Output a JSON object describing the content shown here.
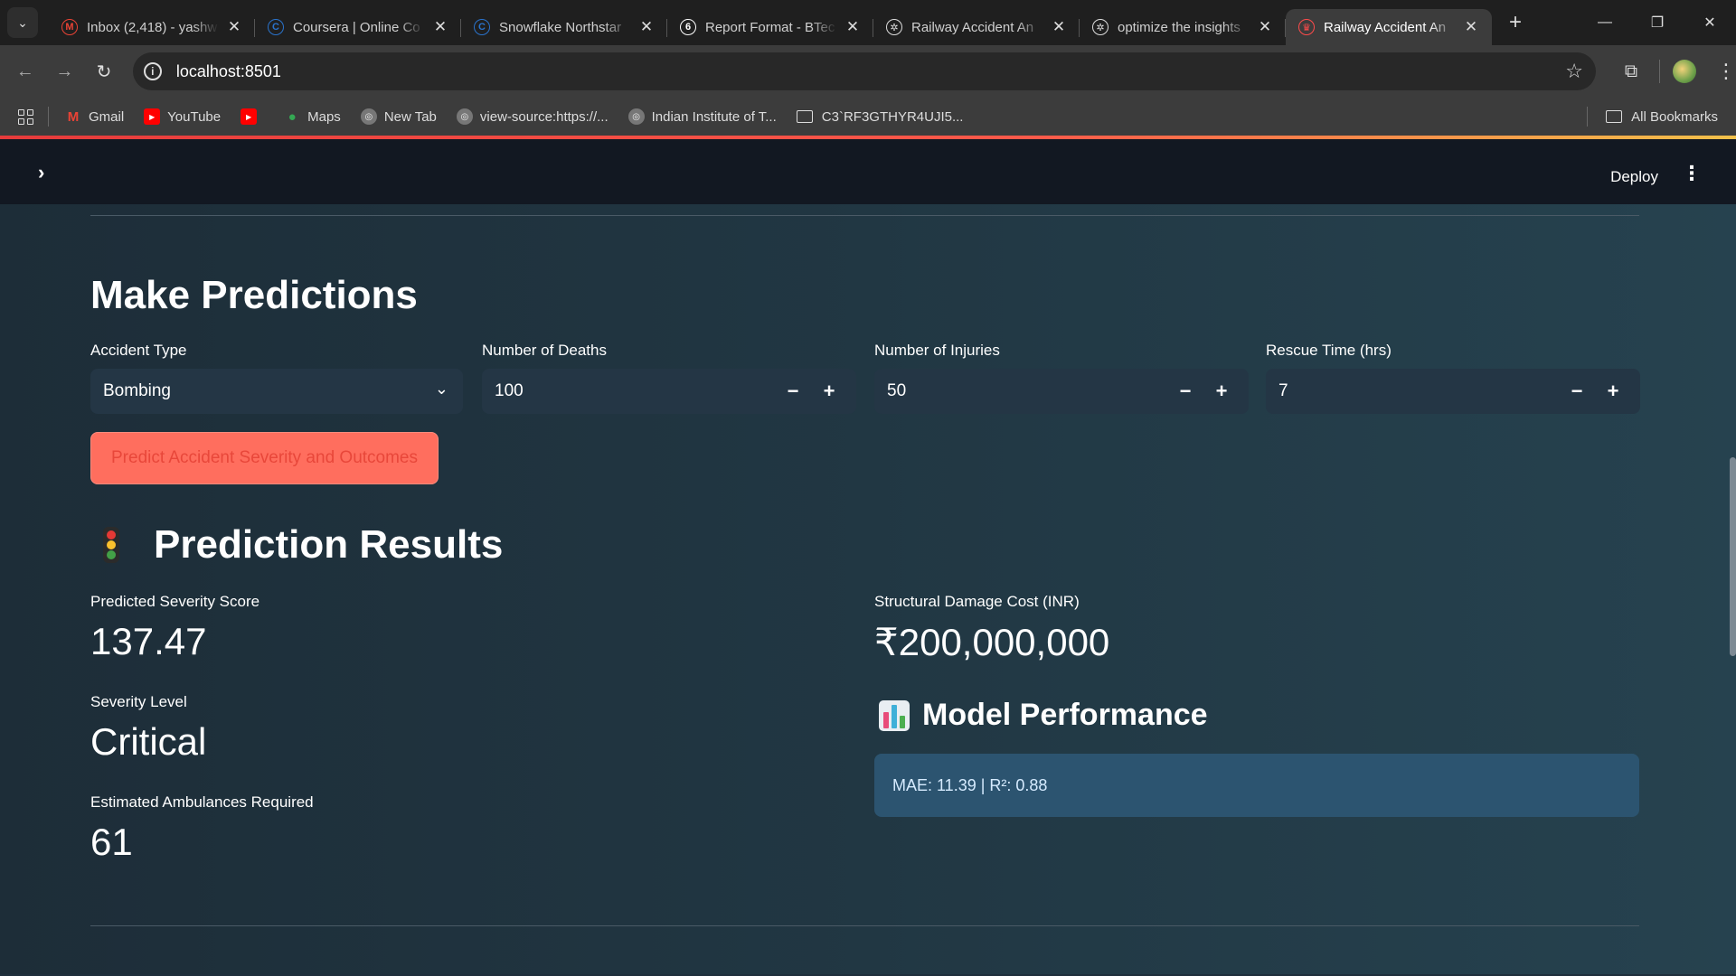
{
  "browser": {
    "tabs": [
      {
        "title": "Inbox (2,418) - yashw",
        "favicon": "gmail-icon",
        "color": "#ea4335",
        "glyph": "M",
        "active": false
      },
      {
        "title": "Coursera | Online Co",
        "favicon": "coursera-icon",
        "color": "#2a73cc",
        "glyph": "C",
        "active": false
      },
      {
        "title": "Snowflake Northstar",
        "favicon": "coursera-icon",
        "color": "#2a73cc",
        "glyph": "C",
        "active": false
      },
      {
        "title": "Report Format - BTec",
        "favicon": "document-icon",
        "color": "#ffffff",
        "glyph": "6",
        "active": false
      },
      {
        "title": "Railway Accident An",
        "favicon": "openai-icon",
        "color": "#dddddd",
        "glyph": "✲",
        "active": false
      },
      {
        "title": "optimize the insights",
        "favicon": "openai-icon",
        "color": "#dddddd",
        "glyph": "✲",
        "active": false
      },
      {
        "title": "Railway Accident An",
        "favicon": "streamlit-icon",
        "color": "#ff4b4b",
        "glyph": "♛",
        "active": true
      }
    ],
    "url": "localhost:8501",
    "bookmarks": [
      {
        "label": "Gmail",
        "icon": "gmail-icon",
        "color": "#ea4335",
        "glyph": "M"
      },
      {
        "label": "YouTube",
        "icon": "youtube-icon",
        "color": "#ff0000",
        "glyph": "▶"
      },
      {
        "label": "",
        "icon": "youtube-icon",
        "color": "#ff0000",
        "glyph": "▶"
      },
      {
        "label": "Maps",
        "icon": "maps-pin-icon",
        "color": "#34a853",
        "glyph": "●"
      },
      {
        "label": "New Tab",
        "icon": "globe-icon",
        "color": "#777777",
        "glyph": "◎"
      },
      {
        "label": "view-source:https://...",
        "icon": "globe-icon",
        "color": "#777777",
        "glyph": "◎"
      },
      {
        "label": "Indian Institute of T...",
        "icon": "globe-icon",
        "color": "#777777",
        "glyph": "◎"
      },
      {
        "label": "C3`RF3GTHYR4UJI5...",
        "icon": "folder-icon",
        "color": "",
        "glyph": ""
      }
    ],
    "all_bookmarks": "All Bookmarks"
  },
  "header": {
    "deploy": "Deploy"
  },
  "main": {
    "title": "Make Predictions",
    "fields": {
      "accident_type": {
        "label": "Accident Type",
        "value": "Bombing"
      },
      "deaths": {
        "label": "Number of Deaths",
        "value": "100"
      },
      "injuries": {
        "label": "Number of Injuries",
        "value": "50"
      },
      "rescue_time": {
        "label": "Rescue Time (hrs)",
        "value": "7"
      }
    },
    "predict_button": "Predict Accident Severity and Outcomes",
    "results_title": "Prediction Results",
    "metrics": {
      "severity_score": {
        "label": "Predicted Severity Score",
        "value": "137.47"
      },
      "damage_cost": {
        "label": "Structural Damage Cost (INR)",
        "value": "₹200,000,000"
      },
      "severity_level": {
        "label": "Severity Level",
        "value": "Critical"
      },
      "ambulances": {
        "label": "Estimated Ambulances Required",
        "value": "61"
      }
    },
    "performance": {
      "title": "Model Performance",
      "text": "MAE: 11.39 | R²: 0.88"
    }
  },
  "colors": {
    "accent": "#ff4b4b",
    "button_bg": "#ff6e5e",
    "info_bg": "#2c5470",
    "header_bg": "#121822"
  }
}
